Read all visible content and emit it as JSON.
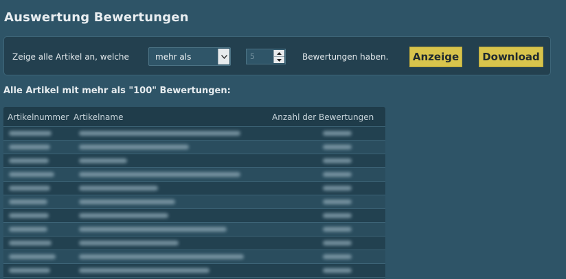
{
  "page": {
    "title": "Auswertung Bewertungen"
  },
  "filter": {
    "prefix": "Zeige alle Artikel an, welche",
    "select_value": "mehr als",
    "count_value": "5",
    "suffix": "Bewertungen haben.",
    "show_button": "Anzeige",
    "download_button": "Download"
  },
  "results": {
    "heading": "Alle Artikel mit mehr als \"100\" Bewertungen:"
  },
  "table": {
    "columns": [
      "Artikelnummer",
      "Artikelname",
      "Anzahl der Bewertungen"
    ],
    "rows": [
      {
        "number": "",
        "name": "",
        "count": ""
      },
      {
        "number": "",
        "name": "",
        "count": ""
      },
      {
        "number": "",
        "name": "",
        "count": ""
      },
      {
        "number": "",
        "name": "",
        "count": ""
      },
      {
        "number": "",
        "name": "",
        "count": ""
      },
      {
        "number": "",
        "name": "",
        "count": ""
      },
      {
        "number": "",
        "name": "",
        "count": ""
      },
      {
        "number": "",
        "name": "",
        "count": ""
      },
      {
        "number": "",
        "name": "",
        "count": ""
      },
      {
        "number": "",
        "name": "",
        "count": ""
      },
      {
        "number": "",
        "name": "",
        "count": ""
      }
    ]
  },
  "icons": {
    "select_arrow": "chevron-down-icon",
    "spin_up": "spin-up-icon",
    "spin_down": "spin-down-icon"
  },
  "colors": {
    "background": "#2e5467",
    "panel": "#23404f",
    "button": "#d8c44c"
  }
}
